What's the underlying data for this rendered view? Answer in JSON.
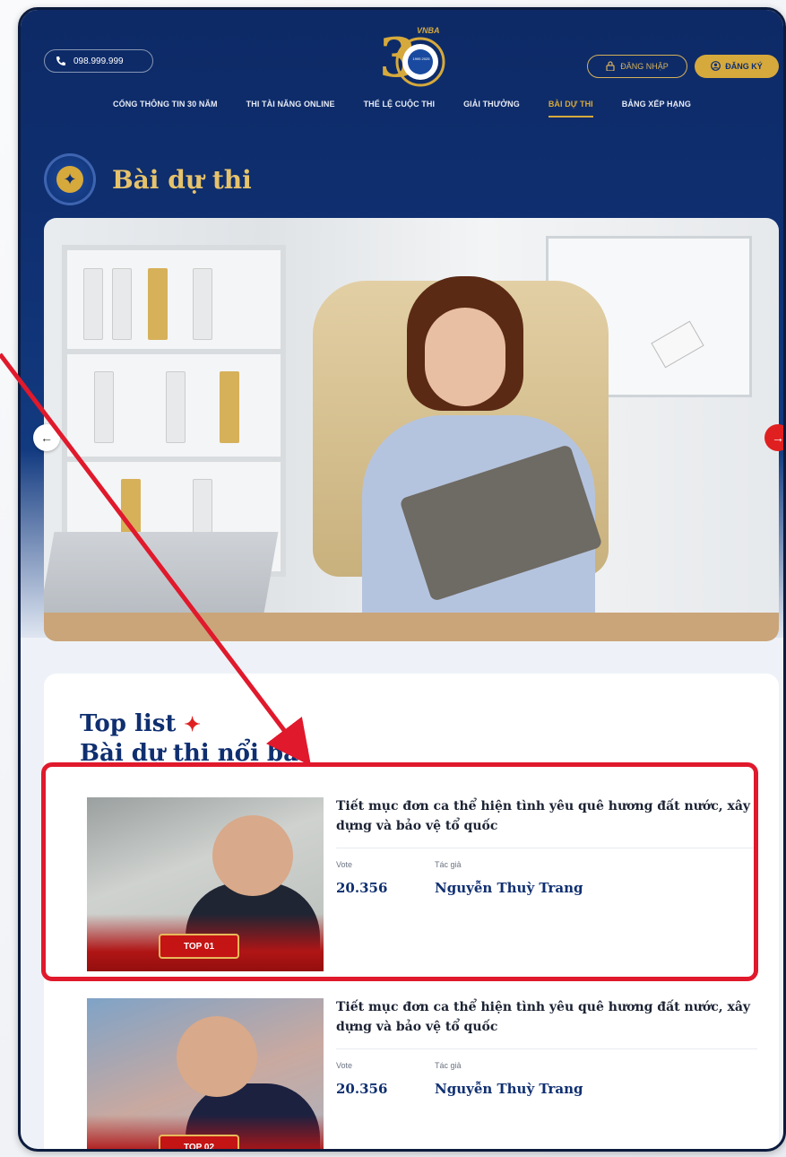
{
  "header": {
    "phone": "098.999.999",
    "logo_text": "VNBA",
    "logo_small": "1995 2025",
    "login_label": "ĐĂNG NHẬP",
    "register_label": "ĐĂNG KÝ"
  },
  "nav": {
    "items": [
      {
        "label": "CỔNG THÔNG TIN 30 NĂM",
        "active": false
      },
      {
        "label": "THI TÀI NĂNG ONLINE",
        "active": false
      },
      {
        "label": "THỂ LỆ CUỘC THI",
        "active": false
      },
      {
        "label": "GIẢI THƯỞNG",
        "active": false
      },
      {
        "label": "BÀI DỰ THI",
        "active": true
      },
      {
        "label": "BẢNG XẾP HẠNG",
        "active": false
      }
    ]
  },
  "page": {
    "title": "Bài dự thi"
  },
  "toplist": {
    "title_line1": "Top list",
    "title_line2": "Bài dự thi nổi bật",
    "entries": [
      {
        "badge": "TOP 01",
        "title": "Tiết mục đơn ca thể hiện tình yêu quê hương đất nước, xây dựng và bảo vệ tổ quốc",
        "vote_label": "Vote",
        "vote_value": "20.356",
        "author_label": "Tác giả",
        "author_value": "Nguyễn Thuỳ Trang"
      },
      {
        "badge": "TOP 02",
        "title": "Tiết mục đơn ca thể hiện tình yêu quê hương đất nước, xây dựng và bảo vệ tổ quốc",
        "vote_label": "Vote",
        "vote_value": "20.356",
        "author_label": "Tác giả",
        "author_value": "Nguyễn Thuỳ Trang"
      }
    ]
  },
  "colors": {
    "navy": "#0f2f70",
    "gold": "#d6a93c",
    "annotation_red": "#e0192c"
  }
}
